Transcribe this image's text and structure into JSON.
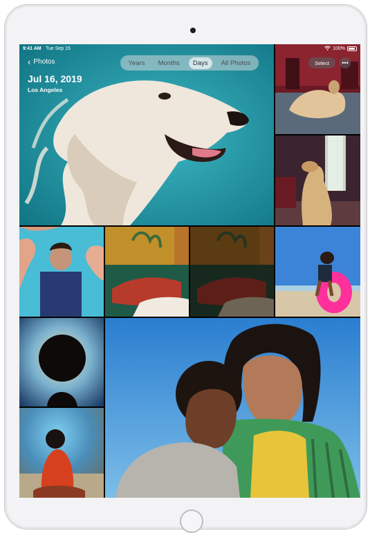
{
  "status_bar": {
    "time": "9:41 AM",
    "date": "Tue Sep 15",
    "battery": "100%"
  },
  "nav": {
    "back_label": "Photos",
    "date_title": "Jul 16, 2019",
    "location": "Los Angeles"
  },
  "segmented_control": {
    "options": [
      "Years",
      "Months",
      "Days",
      "All Photos"
    ],
    "selected": "Days"
  },
  "toolbar": {
    "select_label": "Select",
    "more_label": "•••"
  },
  "photos": [
    {
      "name": "afghan-hound-teal",
      "accent": "#2aa1b0"
    },
    {
      "name": "hound-on-rug",
      "accent": "#7a1f2a"
    },
    {
      "name": "hound-by-window",
      "accent": "#4a2b33"
    },
    {
      "name": "woman-hands-blue",
      "accent": "#3fb3cf"
    },
    {
      "name": "woman-on-couch",
      "accent": "#b58a2a"
    },
    {
      "name": "woman-on-couch-dark",
      "accent": "#5a3a12"
    },
    {
      "name": "man-pink-float",
      "accent": "#3b78d2"
    },
    {
      "name": "silhouette-afro",
      "accent": "#3a6f9e"
    },
    {
      "name": "woman-red-coat",
      "accent": "#d24a22"
    },
    {
      "name": "couple-portrait",
      "accent": "#2f86d6"
    }
  ]
}
